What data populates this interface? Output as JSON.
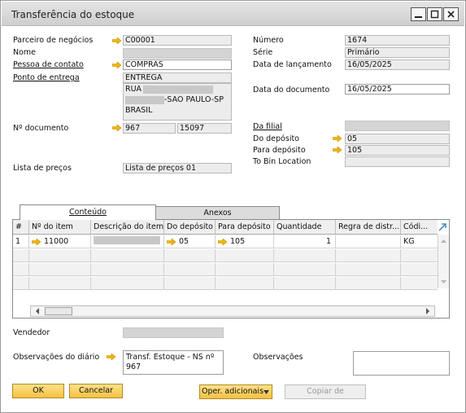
{
  "window": {
    "title": "Transferência do estoque"
  },
  "header_left": {
    "partner_label": "Parceiro de negócios",
    "partner_value": "C00001",
    "name_label": "Nome",
    "contact_label": "Pessoa de contato",
    "contact_value": "COMPRAS",
    "delivery_label": "Ponto de entrega",
    "delivery_value": "ENTREGA",
    "address_line1": "RUA",
    "address_line2": "-SAO PAULO-SP",
    "address_line3": "BRASIL",
    "docnum_label": "Nº documento",
    "docnum_value1": "967",
    "docnum_value2": "15097",
    "pricelist_label": "Lista de preços",
    "pricelist_value": "Lista de preços 01"
  },
  "header_right": {
    "number_label": "Número",
    "number_value": "1674",
    "series_label": "Série",
    "series_value": "Primário",
    "posting_label": "Data de lançamento",
    "posting_value": "16/05/2025",
    "docdate_label": "Data do documento",
    "docdate_value": "16/05/2025",
    "branch_label": "Da filial",
    "from_wh_label": "Do depósito",
    "from_wh_value": "05",
    "to_wh_label": "Para depósito",
    "to_wh_value": "105",
    "bin_label": "To Bin Location"
  },
  "tabs": {
    "content": "Conteúdo",
    "attachments": "Anexos"
  },
  "grid": {
    "headers": [
      "#",
      "Nº do item",
      "Descrição do item",
      "Do depósito",
      "Para depósito",
      "Quantidade",
      "Regra de distr...",
      "Códi..."
    ],
    "row1": {
      "num": "1",
      "item": "11000",
      "from_wh": "05",
      "to_wh": "105",
      "qty": "1",
      "uom": "KG"
    }
  },
  "footer": {
    "seller_label": "Vendedor",
    "journal_label": "Observações do diário",
    "journal_value": "Transf. Estoque  - NS nº 967",
    "remarks_label": "Observações",
    "ok": "OK",
    "cancel": "Cancelar",
    "additional": "Oper. adicionais",
    "copy_from": "Copiar de"
  },
  "icons": {
    "link_arrow": "orange-link-arrow-icon",
    "minimize": "minimize-icon",
    "maximize": "maximize-icon",
    "close": "close-icon"
  },
  "colors": {
    "link_arrow": "#f2b705",
    "button_accent": "#f4c143"
  }
}
